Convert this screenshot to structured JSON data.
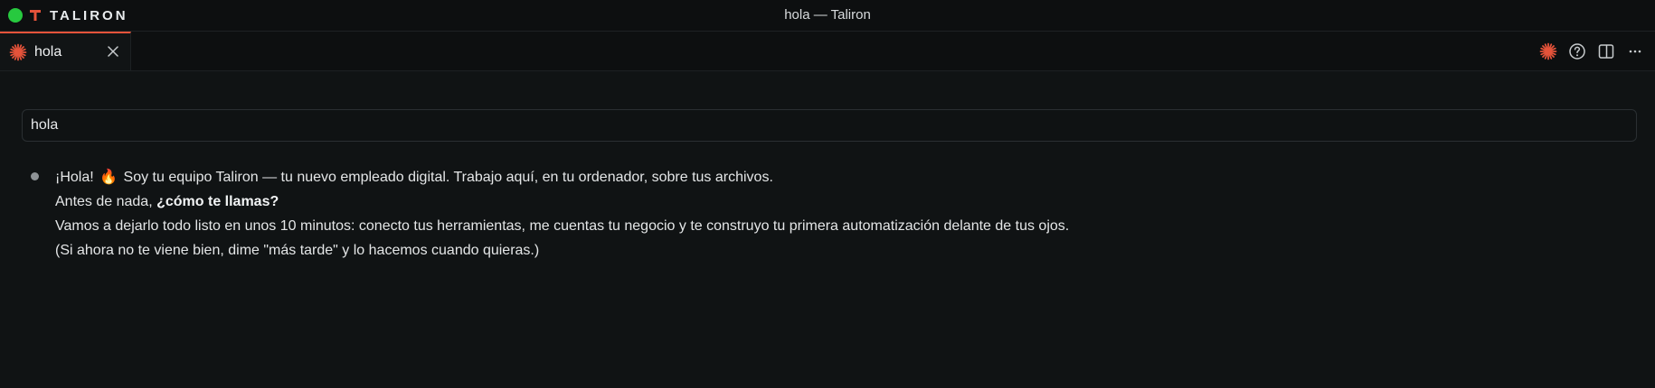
{
  "app": {
    "brand_name": "TALIRON",
    "window_title": "hola — Taliron",
    "accent_color": "#e5533a",
    "status_dot_color": "#27c93f"
  },
  "tabs": [
    {
      "label": "hola",
      "icon": "starburst-icon",
      "active": true
    }
  ],
  "toolbar": {
    "icons": [
      "starburst-icon",
      "help-icon",
      "split-panel-icon",
      "more-icon"
    ]
  },
  "prompt": {
    "value": "hola"
  },
  "message": {
    "line1_prefix": "¡Hola!",
    "line1_emoji": "🔥",
    "line1_suffix": "Soy tu equipo Taliron — tu nuevo empleado digital. Trabajo aquí, en tu ordenador, sobre tus archivos.",
    "line2_prefix": "Antes de nada,",
    "line2_bold": "¿cómo te llamas?",
    "line3": "Vamos a dejarlo todo listo en unos 10 minutos: conecto tus herramientas, me cuentas tu negocio y te construyo tu primera automatización delante de tus ojos.",
    "line4": "(Si ahora no te viene bien, dime \"más tarde\" y lo hacemos cuando quieras.)"
  }
}
